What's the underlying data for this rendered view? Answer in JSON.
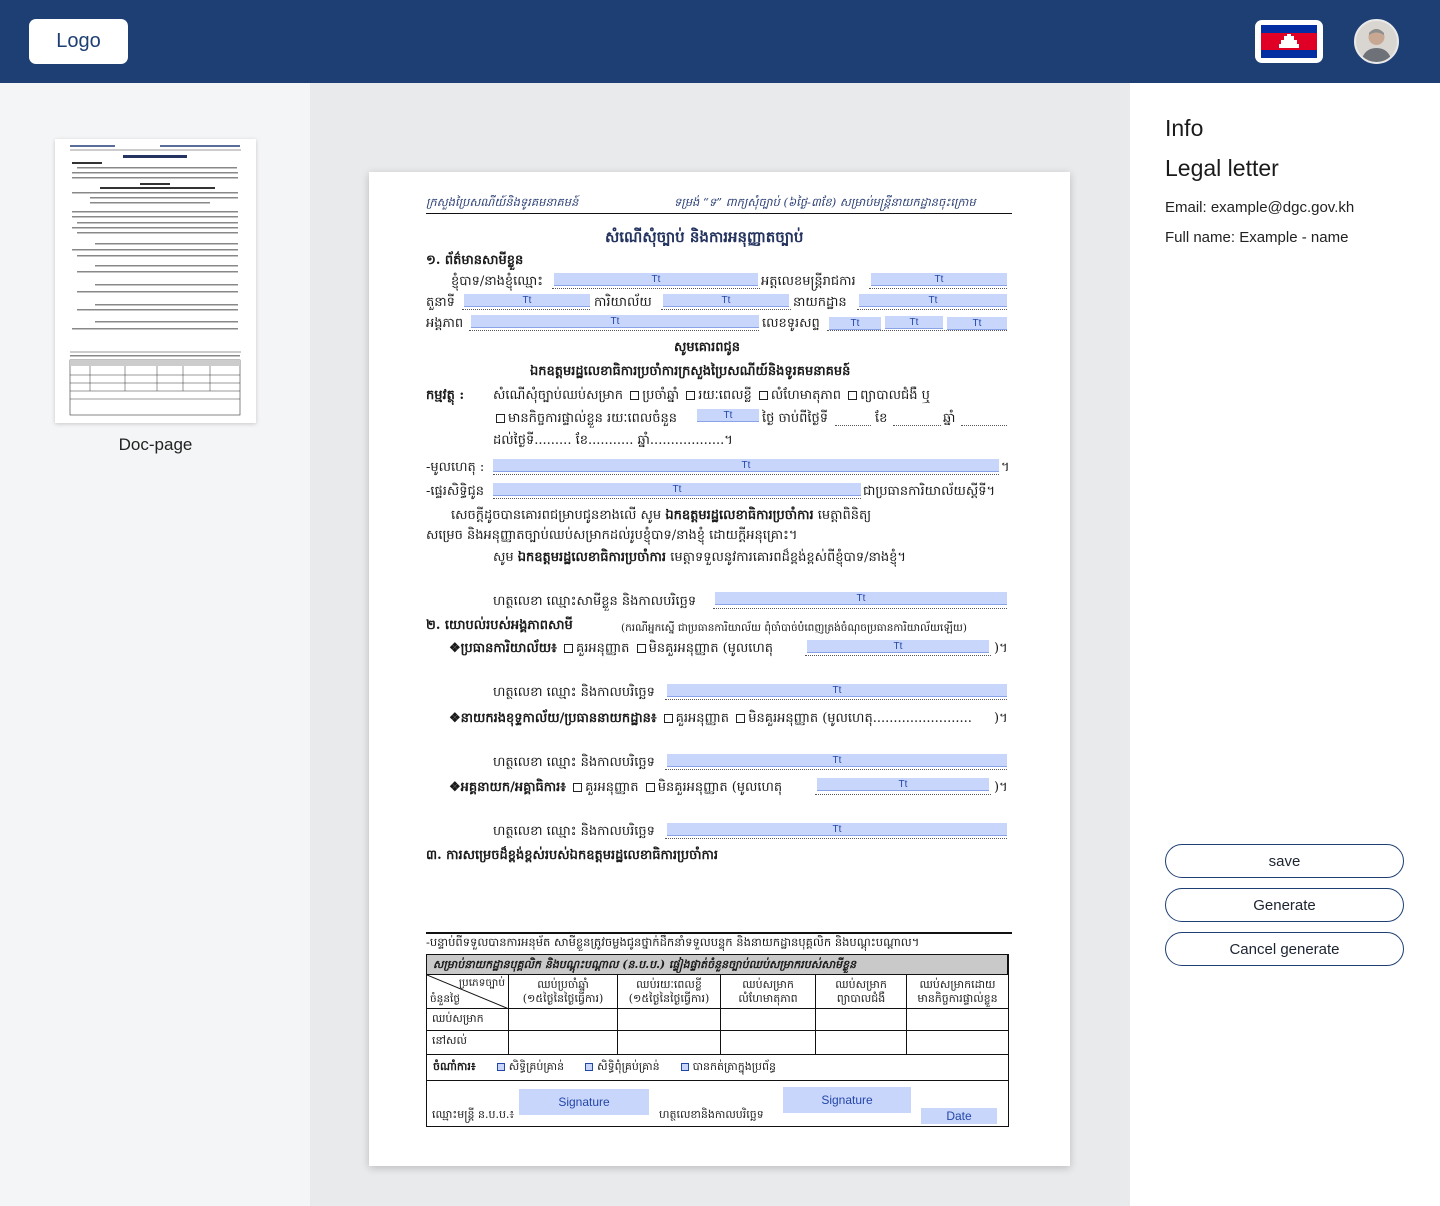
{
  "header": {
    "logo_label": "Logo",
    "language_flag": "cambodia-flag-icon",
    "avatar": "user-avatar-icon"
  },
  "sidebar": {
    "pages": [
      {
        "caption": "Doc-page"
      }
    ]
  },
  "document": {
    "header_left": "ក្រសួងប្រៃសណីយ៍និងទូរគមនាគមន៍",
    "header_right": "ទម្រង់ “ទ” ពាក្យសុំច្បាប់ (៦ថ្ងៃ-៣ខែ) សម្រាប់មន្ត្រីនាយកដ្ឋានចុះក្រោម",
    "title": "សំណើសុំច្បាប់ និងការអនុញ្ញាតច្បាប់",
    "section1": {
      "heading": "១. ព័ត៌មានសាមីខ្លួន",
      "name_label": "ខ្ញុំបាទ/នាងខ្ញុំឈ្មោះ",
      "id_label": "អត្តលេខមន្ត្រីរាជការ",
      "role_label": "តួនាទី",
      "office_label": "ការិយាល័យ",
      "dept_label": "នាយកដ្ឋាន",
      "unit_label": "អង្គភាព",
      "phone_label": "លេខទូរសព្ទ"
    },
    "salutation": "សូមគោរពជូន",
    "addressee": "ឯកឧត្តមរដ្ឋលេខាធិការប្រចាំការក្រសួងប្រៃសណីយ៍និងទូរគមនាគមន៍",
    "subject": {
      "label": "កម្មវត្ថុ :",
      "line1_prefix": "សំណើសុំច្បាប់ឈប់សម្រាក",
      "opt_annual": "ប្រចាំឆ្នាំ",
      "opt_short": "រយៈពេលខ្លី",
      "opt_maternity": "លំហែមាតុភាព",
      "opt_illness": "ព្យាបាលជំងឺ ឬ",
      "line2_prefix": "មានកិច្ចការផ្ទាល់ខ្លួន រយៈពេលចំនួន",
      "days_from": "ថ្ងៃ ចាប់ពីថ្ងៃទី",
      "month": "ខែ",
      "year": "ឆ្នាំ",
      "until_line": "ដល់ថ្ងៃទី......... ខែ........... ឆ្នាំ..................។"
    },
    "reason_label": "-មូលហេតុ :",
    "delegate_label": "-ផ្ទេរសិទ្ធិជូន",
    "delegate_suffix": "ជាប្រធានការិយាល័យស្ដីទី។",
    "para1_a": "សេចក្ដីដូចបានគោរពជម្រាបជូនខាងលើ សូម",
    "para1_bold": "ឯកឧត្តមរដ្ឋលេខាធិការប្រចាំការ",
    "para1_b": "មេត្តាពិនិត្យ",
    "para1_line2": "សម្រេច និងអនុញ្ញាតច្បាប់ឈប់សម្រាកដល់រូបខ្ញុំបាទ/នាងខ្ញុំ ដោយក្ដីអនុគ្រោះ។",
    "para2_a": "សូម",
    "para2_bold": "ឯកឧត្តមរដ្ឋលេខាធិការប្រចាំការ",
    "para2_b": "មេត្តាទទួលនូវការគោរពដ៏ខ្ពង់ខ្ពស់ពីខ្ញុំបាទ/នាងខ្ញុំ។",
    "sign_self": "ហត្ថលេខា ឈ្មោះសាមីខ្លួន និងកាលបរិច្ឆេទ",
    "section2_heading": "២. យោបល់របស់អង្គភាពសាមី",
    "section2_note": "(ករណីអ្នកស្នើ ជាប្រធានការិយាល័យ ពុំចាំបាច់បំពេញត្រង់ចំណុចប្រធានការិយាល័យឡើយ)",
    "approve": "គួរអនុញ្ញាត",
    "reject": "មិនគួរអនុញ្ញាត",
    "reason_paren": "(មូលហេតុ",
    "office_head": "❖ប្រធានការិយាល័យ៖",
    "dept_head": "❖នាយករងខុទ្ទកាល័យ/ប្រធាននាយកដ្ឋាន៖",
    "dept_head_dots": "(មូលហេតុ........................",
    "gen_head": "❖អគ្គនាយក/អគ្គាធិការ៖",
    "sign_date": "ហត្ថលេខា ឈ្មោះ និងកាលបរិច្ឆេទ",
    "section3_heading": "៣. ការសម្រេចដ៏ខ្ពង់ខ្ពស់របស់ឯកឧត្តមរដ្ឋលេខាធិការប្រចាំការ",
    "footnote": "-បន្ទាប់ពីទទួលបានការអនុម័ត សាមីខ្លួនត្រូវចម្លងជូនថ្នាក់ដឹកនាំទទួលបន្ទុក និងនាយកដ្ឋានបុគ្គលិក និងបណ្ដុះបណ្ដាល។",
    "table_title": "សម្រាប់នាយកដ្ឋានបុគ្គលិក និងបណ្ដុះបណ្ដាល (ន.ប.ប.) ផ្ទៀងផ្ទាត់ចំនួនច្បាប់ឈប់សម្រាករបស់សាមីខ្លួន",
    "table_corner_top": "ប្រភេទច្បាប់",
    "table_corner_bottom": "ចំនួនថ្ងៃ",
    "table_cols": [
      "ឈប់ប្រចាំឆ្នាំ\n(១៥ថ្ងៃនៃថ្ងៃធ្វើការ)",
      "ឈប់រយៈពេលខ្លី\n(១៥ថ្ងៃនៃថ្ងៃធ្វើការ)",
      "ឈប់សម្រាក\nលំហែមាតុភាព",
      "ឈប់សម្រាក\nព្យាបាលជំងឺ",
      "ឈប់សម្រាកដោយ\nមានកិច្ចការផ្ទាល់ខ្លួន"
    ],
    "table_rows": [
      "ឈប់សម្រាក",
      "នៅសល់"
    ],
    "remark_label": "ចំណាំការ៖",
    "remark_ok": "សិទ្ធិគ្រប់គ្រាន់",
    "remark_not": "សិទ្ធិពុំគ្រប់គ្រាន់",
    "remark_sent": "បានកត់ត្រាក្នុងប្រព័ន្ធ",
    "officer_label": "ឈ្មោះមន្ត្រី ន.ប.ប.៖",
    "sign_and_date": "ហត្ថលេខានិងកាលបរិច្ឆេទ",
    "field_text": "Tt",
    "signature_label": "Signature",
    "date_label": "Date"
  },
  "info": {
    "heading": "Info",
    "doc_type": "Legal letter",
    "email": "Email: example@dgc.gov.kh",
    "full_name": "Full name: Example - name"
  },
  "actions": {
    "save": "save",
    "generate": "Generate",
    "cancel": "Cancel generate"
  },
  "colors": {
    "header_bg": "#1e3f73",
    "field_bg": "#c8d6fb",
    "field_text": "#2446a8"
  }
}
